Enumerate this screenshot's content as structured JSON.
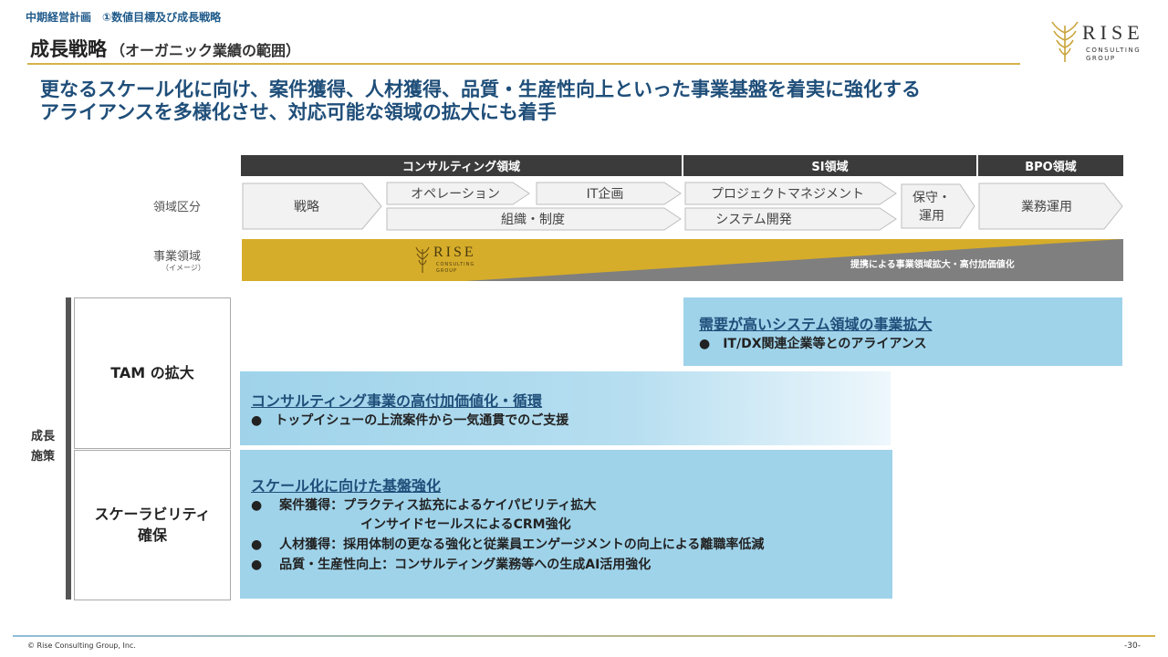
{
  "breadcrumb": "中期経営計画　①数値目標及び成長戦略",
  "title": {
    "main": "成長戦略",
    "sub": "（オーガニック業績の範囲）"
  },
  "logo": {
    "word": "RISE",
    "line1": "CONSULTING",
    "line2": "GROUP"
  },
  "headline": [
    "更なるスケール化に向け、案件獲得、人材獲得、品質・生産性向上といった事業基盤を着実に強化する",
    "アライアンスを多様化させ、対応可能な領域の拡大にも着手"
  ],
  "domains": {
    "consulting": "コンサルティング領域",
    "si": "SI領域",
    "bpo": "BPO領域"
  },
  "rows": {
    "division_label": "領域区分",
    "business_label": "事業領域",
    "business_sub": "（イメージ）"
  },
  "chevrons": {
    "strategy": "戦略",
    "operation": "オペレーション",
    "it_planning": "IT企画",
    "organization": "組織・制度",
    "pm": "プロジェクトマネジメント",
    "system_dev": "システム開発",
    "maintenance_1": "保守・",
    "maintenance_2": "運用",
    "business_ops": "業務運用"
  },
  "business_band": {
    "logo_word": "RISE",
    "logo_line1": "CONSULTING",
    "logo_line2": "GROUP",
    "alliance_text": "提携による事業領域拡大・高付加価値化",
    "colors": {
      "gold": "#d6ad2a",
      "gray": "#7f7f7f"
    }
  },
  "growth_label": [
    "成長",
    "施策"
  ],
  "categories": {
    "tam": "TAM の拡大",
    "scalability_1": "スケーラビリティ",
    "scalability_2": "確保"
  },
  "panels": {
    "system": {
      "title": "需要が高いシステム領域の事業拡大",
      "items": [
        "●　IT/DX関連企業等とのアライアンス"
      ]
    },
    "consulting": {
      "title": "コンサルティング事業の高付加価値化・循環",
      "items": [
        "●　トップイシューの上流案件から一気通貫でのご支援"
      ]
    },
    "scale": {
      "title": "スケール化に向けた基盤強化",
      "items": [
        "●　 案件獲得：プラクティス拡充によるケイパビリティ拡大",
        "インサイドセールスによるCRM強化",
        "●　 人材獲得：採用体制の更なる強化と従業員エンゲージメントの向上による離職率低減",
        "●　 品質・生産性向上：コンサルティング業務等への生成AI活用強化"
      ]
    },
    "color": "#9fd3ea"
  },
  "footer": {
    "copyright": "© Rise Consulting Group, Inc.",
    "page": "-30-"
  }
}
